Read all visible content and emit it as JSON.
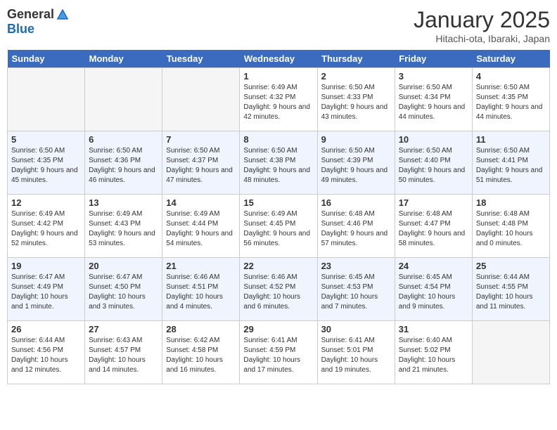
{
  "header": {
    "logo_general": "General",
    "logo_blue": "Blue",
    "title": "January 2025",
    "subtitle": "Hitachi-ota, Ibaraki, Japan"
  },
  "days_of_week": [
    "Sunday",
    "Monday",
    "Tuesday",
    "Wednesday",
    "Thursday",
    "Friday",
    "Saturday"
  ],
  "weeks": [
    [
      {
        "day": "",
        "info": ""
      },
      {
        "day": "",
        "info": ""
      },
      {
        "day": "",
        "info": ""
      },
      {
        "day": "1",
        "info": "Sunrise: 6:49 AM\nSunset: 4:32 PM\nDaylight: 9 hours and 42 minutes."
      },
      {
        "day": "2",
        "info": "Sunrise: 6:50 AM\nSunset: 4:33 PM\nDaylight: 9 hours and 43 minutes."
      },
      {
        "day": "3",
        "info": "Sunrise: 6:50 AM\nSunset: 4:34 PM\nDaylight: 9 hours and 44 minutes."
      },
      {
        "day": "4",
        "info": "Sunrise: 6:50 AM\nSunset: 4:35 PM\nDaylight: 9 hours and 44 minutes."
      }
    ],
    [
      {
        "day": "5",
        "info": "Sunrise: 6:50 AM\nSunset: 4:35 PM\nDaylight: 9 hours and 45 minutes."
      },
      {
        "day": "6",
        "info": "Sunrise: 6:50 AM\nSunset: 4:36 PM\nDaylight: 9 hours and 46 minutes."
      },
      {
        "day": "7",
        "info": "Sunrise: 6:50 AM\nSunset: 4:37 PM\nDaylight: 9 hours and 47 minutes."
      },
      {
        "day": "8",
        "info": "Sunrise: 6:50 AM\nSunset: 4:38 PM\nDaylight: 9 hours and 48 minutes."
      },
      {
        "day": "9",
        "info": "Sunrise: 6:50 AM\nSunset: 4:39 PM\nDaylight: 9 hours and 49 minutes."
      },
      {
        "day": "10",
        "info": "Sunrise: 6:50 AM\nSunset: 4:40 PM\nDaylight: 9 hours and 50 minutes."
      },
      {
        "day": "11",
        "info": "Sunrise: 6:50 AM\nSunset: 4:41 PM\nDaylight: 9 hours and 51 minutes."
      }
    ],
    [
      {
        "day": "12",
        "info": "Sunrise: 6:49 AM\nSunset: 4:42 PM\nDaylight: 9 hours and 52 minutes."
      },
      {
        "day": "13",
        "info": "Sunrise: 6:49 AM\nSunset: 4:43 PM\nDaylight: 9 hours and 53 minutes."
      },
      {
        "day": "14",
        "info": "Sunrise: 6:49 AM\nSunset: 4:44 PM\nDaylight: 9 hours and 54 minutes."
      },
      {
        "day": "15",
        "info": "Sunrise: 6:49 AM\nSunset: 4:45 PM\nDaylight: 9 hours and 56 minutes."
      },
      {
        "day": "16",
        "info": "Sunrise: 6:48 AM\nSunset: 4:46 PM\nDaylight: 9 hours and 57 minutes."
      },
      {
        "day": "17",
        "info": "Sunrise: 6:48 AM\nSunset: 4:47 PM\nDaylight: 9 hours and 58 minutes."
      },
      {
        "day": "18",
        "info": "Sunrise: 6:48 AM\nSunset: 4:48 PM\nDaylight: 10 hours and 0 minutes."
      }
    ],
    [
      {
        "day": "19",
        "info": "Sunrise: 6:47 AM\nSunset: 4:49 PM\nDaylight: 10 hours and 1 minute."
      },
      {
        "day": "20",
        "info": "Sunrise: 6:47 AM\nSunset: 4:50 PM\nDaylight: 10 hours and 3 minutes."
      },
      {
        "day": "21",
        "info": "Sunrise: 6:46 AM\nSunset: 4:51 PM\nDaylight: 10 hours and 4 minutes."
      },
      {
        "day": "22",
        "info": "Sunrise: 6:46 AM\nSunset: 4:52 PM\nDaylight: 10 hours and 6 minutes."
      },
      {
        "day": "23",
        "info": "Sunrise: 6:45 AM\nSunset: 4:53 PM\nDaylight: 10 hours and 7 minutes."
      },
      {
        "day": "24",
        "info": "Sunrise: 6:45 AM\nSunset: 4:54 PM\nDaylight: 10 hours and 9 minutes."
      },
      {
        "day": "25",
        "info": "Sunrise: 6:44 AM\nSunset: 4:55 PM\nDaylight: 10 hours and 11 minutes."
      }
    ],
    [
      {
        "day": "26",
        "info": "Sunrise: 6:44 AM\nSunset: 4:56 PM\nDaylight: 10 hours and 12 minutes."
      },
      {
        "day": "27",
        "info": "Sunrise: 6:43 AM\nSunset: 4:57 PM\nDaylight: 10 hours and 14 minutes."
      },
      {
        "day": "28",
        "info": "Sunrise: 6:42 AM\nSunset: 4:58 PM\nDaylight: 10 hours and 16 minutes."
      },
      {
        "day": "29",
        "info": "Sunrise: 6:41 AM\nSunset: 4:59 PM\nDaylight: 10 hours and 17 minutes."
      },
      {
        "day": "30",
        "info": "Sunrise: 6:41 AM\nSunset: 5:01 PM\nDaylight: 10 hours and 19 minutes."
      },
      {
        "day": "31",
        "info": "Sunrise: 6:40 AM\nSunset: 5:02 PM\nDaylight: 10 hours and 21 minutes."
      },
      {
        "day": "",
        "info": ""
      }
    ]
  ]
}
